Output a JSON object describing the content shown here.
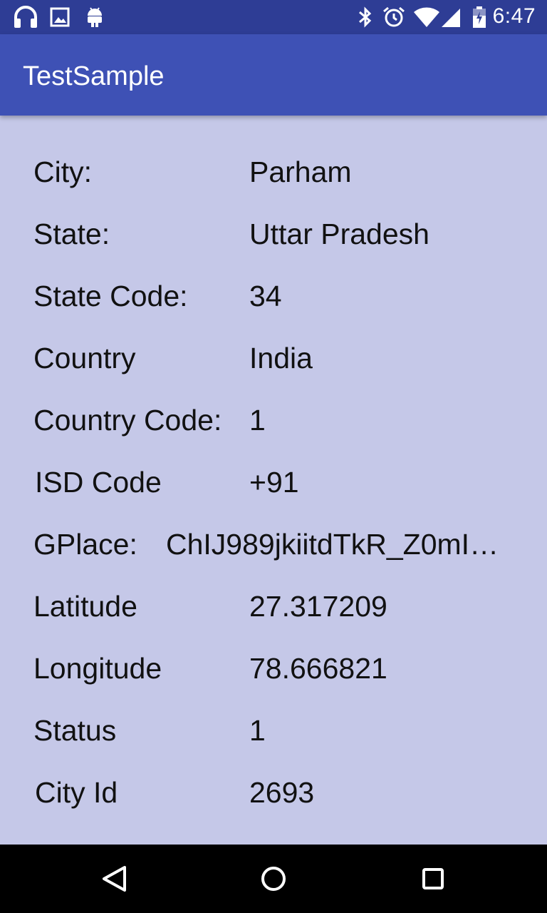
{
  "status_bar": {
    "left_icons": [
      "headphones-icon",
      "image-icon",
      "android-icon"
    ],
    "right_icons": [
      "bluetooth-icon",
      "alarm-icon",
      "wifi-icon",
      "signal-icon",
      "battery-icon"
    ],
    "time": "6:47",
    "color": "#2e3d95"
  },
  "app_bar": {
    "title": "TestSample",
    "color": "#3e51b5"
  },
  "content": {
    "background": "#c5c8e8",
    "rows": [
      {
        "label": "City:",
        "value": "Parham"
      },
      {
        "label": "State:",
        "value": "Uttar Pradesh"
      },
      {
        "label": "State Code:",
        "value": "34"
      },
      {
        "label": "Country",
        "value": "India"
      },
      {
        "label": "Country Code:",
        "value": "1"
      },
      {
        "label": "ISD Code",
        "value": "+91"
      },
      {
        "label": "GPlace:",
        "value": "ChIJ989jkiitdTkR_Z0mI…"
      },
      {
        "label": "Latitude",
        "value": "27.317209"
      },
      {
        "label": "Longitude",
        "value": "78.666821"
      },
      {
        "label": "Status",
        "value": "1"
      },
      {
        "label": "City Id",
        "value": "2693"
      }
    ]
  },
  "nav_bar": {
    "buttons": [
      "back-icon",
      "home-icon",
      "recents-icon"
    ]
  }
}
